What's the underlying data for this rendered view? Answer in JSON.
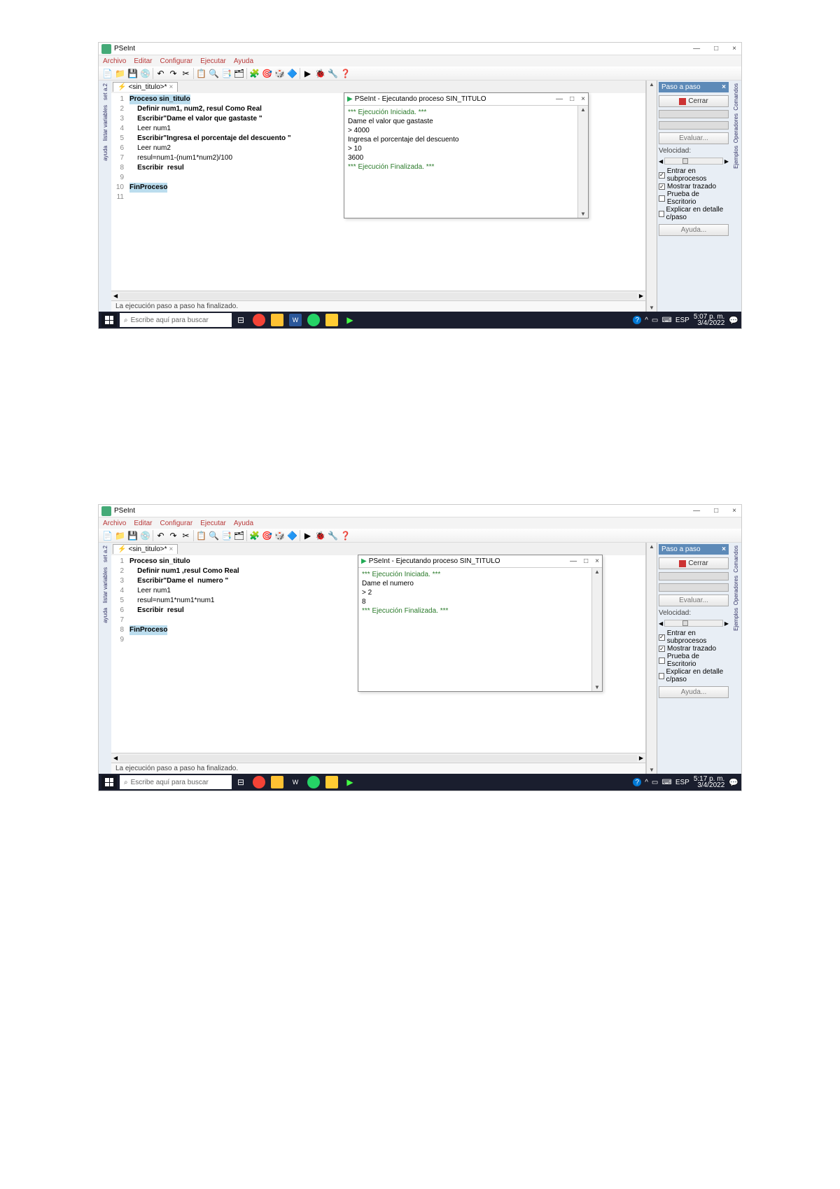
{
  "app": {
    "title": "PSeInt"
  },
  "window_controls": {
    "min": "—",
    "max": "□",
    "close": "×"
  },
  "menu": [
    "Archivo",
    "Editar",
    "Configurar",
    "Ejecutar",
    "Ayuda"
  ],
  "toolbar_icons": [
    "📄",
    "📁",
    "💾",
    "💿",
    "↶",
    "↷",
    "✂",
    "📋",
    "🔍",
    "📑",
    "🗂",
    "🧩",
    "🎯",
    "🎲",
    "🔷",
    "▶",
    "🐞",
    "🔧",
    "❓"
  ],
  "doc_tab": {
    "label": "<sin_titulo>*",
    "close": "×"
  },
  "vtabs1": [
    "set a.2",
    "listar variables",
    "ayuda"
  ],
  "vtabs2": [
    "Comandos",
    "Operadores",
    "Ejemplos"
  ],
  "code1": {
    "lines": [
      {
        "n": "1",
        "t": "Proceso sin_titulo",
        "k": true,
        "hl": true
      },
      {
        "n": "2",
        "t": "    Definir num1, num2, resul Como Real",
        "k": true
      },
      {
        "n": "3",
        "t": "    Escribir\"Dame el valor que gastaste \"",
        "k": true
      },
      {
        "n": "4",
        "t": "    Leer num1",
        "k": false
      },
      {
        "n": "5",
        "t": "    Escribir\"Ingresa el porcentaje del descuento \"",
        "k": true
      },
      {
        "n": "6",
        "t": "    Leer num2",
        "k": false
      },
      {
        "n": "7",
        "t": "    resul=num1-(num1*num2)/100",
        "k": false
      },
      {
        "n": "8",
        "t": "    Escribir  resul",
        "k": true
      },
      {
        "n": "9",
        "t": "",
        "k": false
      },
      {
        "n": "10",
        "t": "FinProceso",
        "k": true,
        "hl": true
      },
      {
        "n": "11",
        "t": "",
        "k": false
      }
    ]
  },
  "console1": {
    "title": "PSeInt - Ejecutando proceso SIN_TITULO",
    "lines": [
      {
        "t": "*** Ejecución Iniciada. ***",
        "c": "green"
      },
      {
        "t": "Dame el valor que gastaste"
      },
      {
        "t": "> 4000"
      },
      {
        "t": "Ingresa el porcentaje del descuento"
      },
      {
        "t": "> 10"
      },
      {
        "t": "3600"
      },
      {
        "t": "*** Ejecución Finalizada. ***",
        "c": "green"
      }
    ]
  },
  "right_panel": {
    "title": "Paso a paso",
    "cerrar": "Cerrar",
    "evaluar": "Evaluar...",
    "velocidad": "Velocidad:",
    "opts": [
      "Entrar en subprocesos",
      "Mostrar trazado",
      "Prueba de Escritorio",
      "Explicar en detalle c/paso"
    ],
    "ayuda": "Ayuda..."
  },
  "status": "La ejecución paso a paso ha finalizado.",
  "taskbar": {
    "search": "Escribe aquí para buscar",
    "lang": "ESP",
    "time1": "5:07 p. m.",
    "date1": "3/4/2022",
    "time2": "5:17 p. m.",
    "date2": "3/4/2022"
  },
  "code2": {
    "lines": [
      {
        "n": "1",
        "t": "Proceso sin_titulo",
        "k": true
      },
      {
        "n": "2",
        "t": "    Definir num1 ,resul Como Real",
        "k": true
      },
      {
        "n": "3",
        "t": "    Escribir\"Dame el  numero \"",
        "k": true
      },
      {
        "n": "4",
        "t": "    Leer num1",
        "k": false
      },
      {
        "n": "5",
        "t": "    resul=num1*num1*num1",
        "k": false
      },
      {
        "n": "6",
        "t": "    Escribir  resul",
        "k": true
      },
      {
        "n": "7",
        "t": "",
        "k": false
      },
      {
        "n": "8",
        "t": "FinProceso",
        "k": true,
        "hl": true
      },
      {
        "n": "9",
        "t": "",
        "k": false
      }
    ]
  },
  "console2": {
    "title": "PSeInt - Ejecutando proceso SIN_TITULO",
    "lines": [
      {
        "t": "*** Ejecución Iniciada. ***",
        "c": "green"
      },
      {
        "t": "Dame el  numero"
      },
      {
        "t": "> 2"
      },
      {
        "t": "8"
      },
      {
        "t": "*** Ejecución Finalizada. ***",
        "c": "green"
      }
    ]
  },
  "checks1": [
    true,
    true,
    false,
    false
  ],
  "checks2": [
    true,
    true,
    false,
    false
  ]
}
